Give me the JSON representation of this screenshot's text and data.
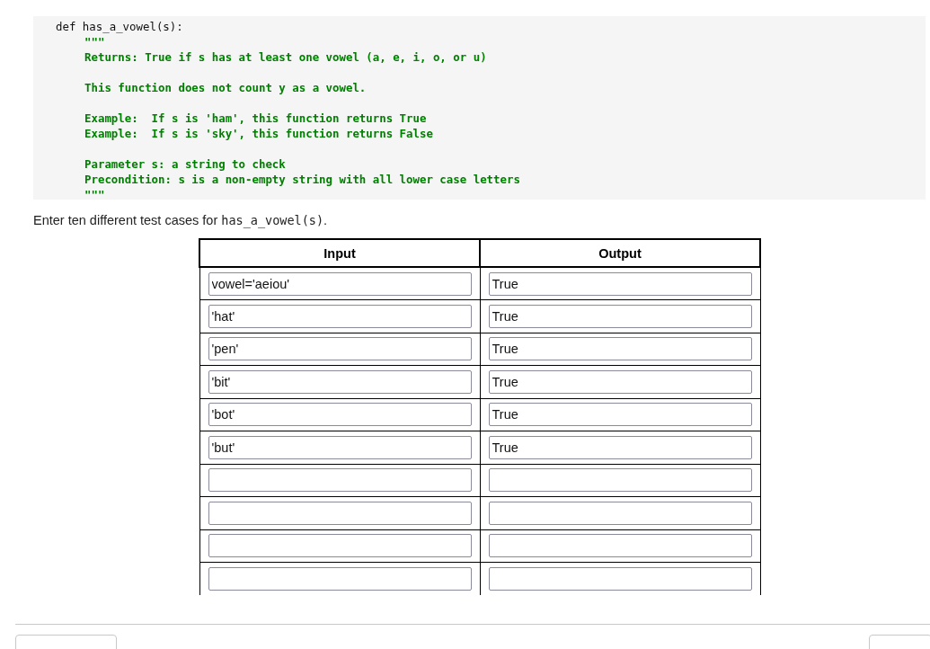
{
  "code": {
    "signature": "def has_a_vowel(s):",
    "docstring_groups": [
      [
        "\"\"\"",
        "Returns: True if s has at least one vowel (a, e, i, o, or u)"
      ],
      [
        "This function does not count y as a vowel."
      ],
      [
        "Example:  If s is 'ham', this function returns True",
        "Example:  If s is 'sky', this function returns False"
      ],
      [
        "Parameter s: a string to check",
        "Precondition: s is a non-empty string with all lower case letters",
        "\"\"\""
      ]
    ]
  },
  "prompt": {
    "text": "Enter ten different test cases for",
    "code": "has_a_vowel(s)",
    "end": "."
  },
  "table": {
    "columns": [
      "Input",
      "Output"
    ],
    "rows": [
      {
        "input": "vowel='aeiou'",
        "output": "True"
      },
      {
        "input": "'hat'",
        "output": "True"
      },
      {
        "input": "'pen'",
        "output": "True"
      },
      {
        "input": "'bit'",
        "output": "True"
      },
      {
        "input": "'bot'",
        "output": "True"
      },
      {
        "input": "'but'",
        "output": "True"
      },
      {},
      {},
      {},
      {}
    ]
  },
  "footer_buttons": [
    {
      "kind": "navigation"
    },
    {
      "kind": "navigation"
    }
  ]
}
